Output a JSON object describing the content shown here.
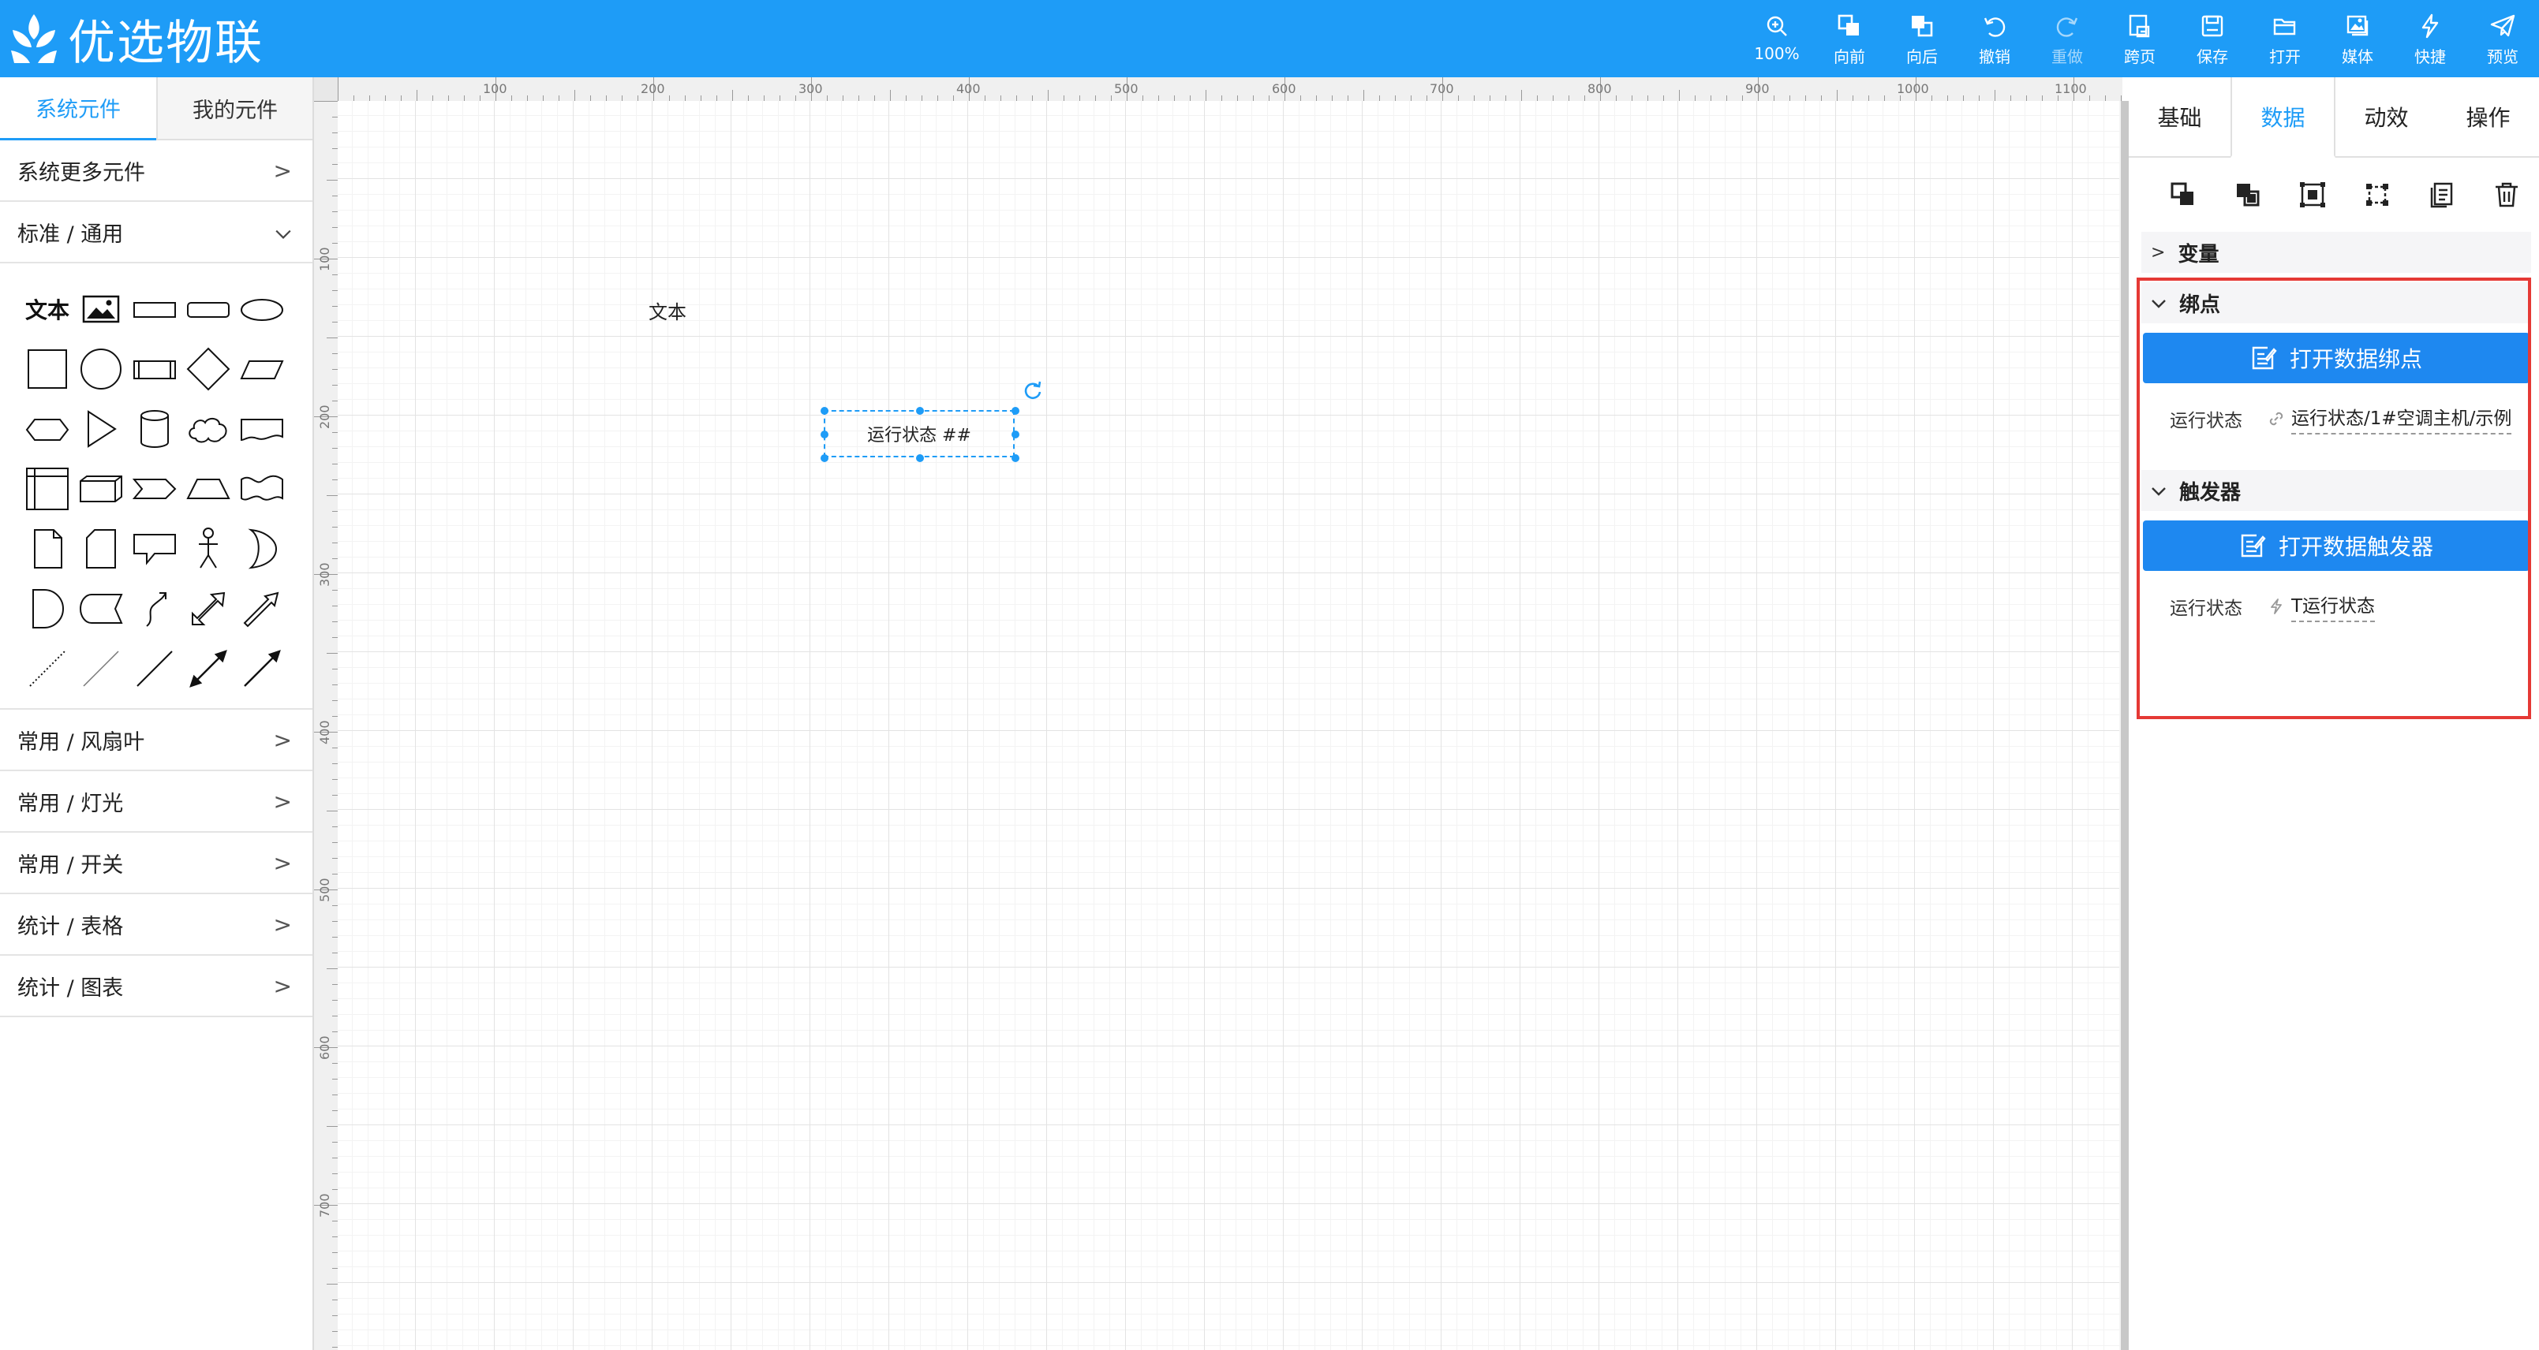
{
  "app": {
    "brand": "优选物联"
  },
  "toolbar": [
    {
      "icon": "zoom-in-icon",
      "label": "100%"
    },
    {
      "icon": "bring-forward-icon",
      "label": "向前"
    },
    {
      "icon": "send-backward-icon",
      "label": "向后"
    },
    {
      "icon": "undo-icon",
      "label": "撤销"
    },
    {
      "icon": "redo-icon",
      "label": "重做"
    },
    {
      "icon": "cross-page-icon",
      "label": "跨页"
    },
    {
      "icon": "save-icon",
      "label": "保存"
    },
    {
      "icon": "folder-open-icon",
      "label": "打开"
    },
    {
      "icon": "media-icon",
      "label": "媒体"
    },
    {
      "icon": "lightning-icon",
      "label": "快捷"
    },
    {
      "icon": "paper-plane-icon",
      "label": "预览"
    }
  ],
  "left": {
    "tabs": [
      {
        "label": "系统元件"
      },
      {
        "label": "我的元件"
      }
    ],
    "more": "系统更多元件",
    "standard": "标准 / 通用",
    "text_shape": "文本",
    "groups": [
      "常用 / 风扇叶",
      "常用 / 灯光",
      "常用 / 开关",
      "统计 / 表格",
      "统计 / 图表"
    ]
  },
  "canvas": {
    "ruler_top": [
      "100",
      "200",
      "300",
      "400",
      "500",
      "600",
      "700",
      "800",
      "900",
      "1000",
      "1100"
    ],
    "ruler_left": [
      "100",
      "200",
      "300",
      "400",
      "500",
      "600",
      "700"
    ],
    "text_element": "文本",
    "selected_element": "运行状态 ##"
  },
  "right": {
    "tabs": [
      {
        "label": "基础"
      },
      {
        "label": "数据"
      },
      {
        "label": "动效"
      },
      {
        "label": "操作"
      }
    ],
    "variables": "变量",
    "binding": {
      "title": "绑点",
      "button": "打开数据绑点",
      "key": "运行状态",
      "value": "运行状态/1#空调主机/示例"
    },
    "trigger": {
      "title": "触发器",
      "button": "打开数据触发器",
      "key": "运行状态",
      "value": "T运行状态"
    }
  }
}
